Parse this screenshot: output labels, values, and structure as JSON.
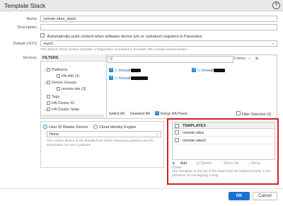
{
  "dialog": {
    "title": "Template Stack"
  },
  "form": {
    "name_label": "Name",
    "name_value": "remote-sites_stack",
    "description_label": "Description",
    "description_value": "",
    "autopush_label": "Automatically push content when software device (vm or container) registers to Panorama",
    "default_vsys_label": "Default VSYS",
    "default_vsys_value": "vsys1",
    "default_vsys_hint": "The default virtual system template configuration is pushed to firewalls with a single virtual system.",
    "devices_label": "Devices"
  },
  "filters": {
    "header": "FILTERS",
    "items": [
      {
        "label": "Platforms"
      },
      {
        "label": "PA-440 (3)"
      },
      {
        "label": "Device Groups"
      },
      {
        "label": "remote-site (3)"
      },
      {
        "label": "Tags"
      },
      {
        "label": "HA Cluster ID"
      },
      {
        "label": "HA Cluster State"
      }
    ]
  },
  "devices": {
    "count": "3 items",
    "tiles": [
      {
        "name": "firewall"
      },
      {
        "name": "firewall"
      },
      {
        "name": "firewall"
      }
    ],
    "select_all": "Select All",
    "deselect_all": "Deselect All",
    "group_ha_peers": "Group HA Peers",
    "filter_selected": "Filter Selected (3)"
  },
  "master": {
    "option_user_id": "User ID Master Device",
    "option_cloud": "Cloud Identity Engine",
    "select_value": "None",
    "hint": "The master device is the firewall from which Panorama gathers user ID information for use in policies."
  },
  "templates": {
    "header": "TEMPLATES",
    "rows": [
      {
        "name": "remote-sites"
      },
      {
        "name": "remote-sites2"
      }
    ],
    "tools": {
      "add": "Add",
      "delete": "Delete",
      "move_up": "Move Up",
      "move_down": "Move Down"
    },
    "hint": "The Template at the top of the Stack has the highest priority in the presence of overlapping config"
  },
  "buttons": {
    "ok": "OK",
    "cancel": "Cancel"
  },
  "colors": {
    "accent": "#2c8ecf",
    "ok_button": "#1d6fd6",
    "highlight_frame": "#e01b1b"
  }
}
